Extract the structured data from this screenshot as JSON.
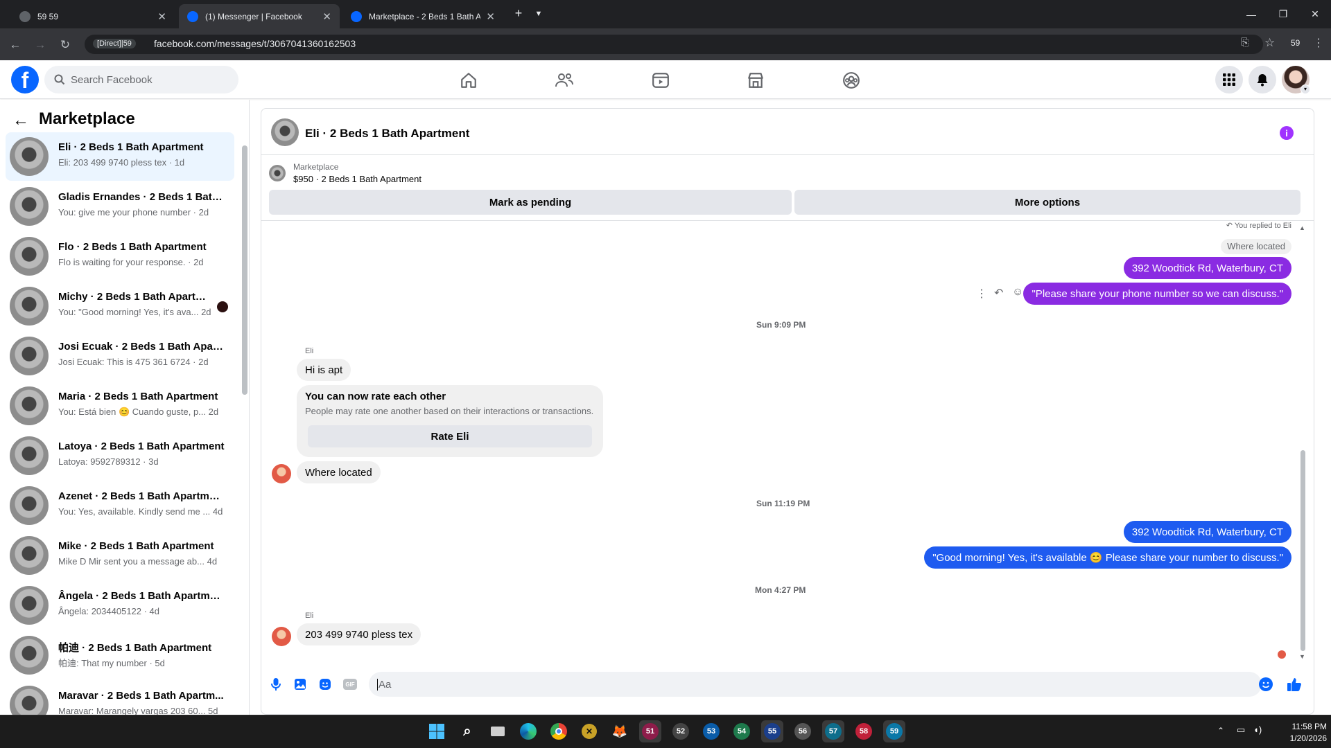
{
  "browser": {
    "tabs": [
      {
        "title": "59 59",
        "active": false
      },
      {
        "title": "(1) Messenger | Facebook",
        "active": true
      },
      {
        "title": "Marketplace - 2 Beds 1 Bath Ap",
        "active": false
      }
    ],
    "address_tag": "[Direct]|59",
    "url": "facebook.com/messages/t/3067041360162503",
    "profile_label": "59"
  },
  "fb": {
    "search_placeholder": "Search Facebook"
  },
  "sidebar": {
    "title": "Marketplace",
    "conversations": [
      {
        "name": "Eli · 2 Beds 1 Bath Apartment",
        "preview": "Eli: 203 499 9740 pless tex · 1d",
        "selected": true
      },
      {
        "name": "Gladis Ernandes · 2 Beds 1 Bath ...",
        "preview": "You: give me your phone number · 2d"
      },
      {
        "name": "Flo · 2 Beds 1 Bath Apartment",
        "preview": "Flo is waiting for your response. · 2d"
      },
      {
        "name": "Michy · 2 Beds 1 Bath Apartm...",
        "preview": "You: \"Good morning! Yes, it's ava... 2d",
        "unread": true
      },
      {
        "name": "Josi Ecuak · 2 Beds 1 Bath Apart...",
        "preview": "Josi Ecuak: This is 475 361 6724 · 2d"
      },
      {
        "name": "Maria · 2 Beds 1 Bath Apartment",
        "preview": "You: Está bien 😊 Cuando guste, p...  2d"
      },
      {
        "name": "Latoya · 2 Beds 1 Bath Apartment",
        "preview": "Latoya: 9592789312 · 3d"
      },
      {
        "name": "Azenet · 2 Beds 1 Bath Apartment",
        "preview": "You: Yes, available. Kindly send me ...  4d"
      },
      {
        "name": "Mike · 2 Beds 1 Bath Apartment",
        "preview": "Mike D Mir sent you a message ab...  4d"
      },
      {
        "name": "Ângela · 2 Beds 1 Bath Apartment",
        "preview": "Ângela: 2034405122 · 4d"
      },
      {
        "name": "帕迪 · 2 Beds 1 Bath Apartment",
        "preview": "帕迪: That my number · 5d"
      },
      {
        "name": "Maravar · 2 Beds 1 Bath Apartm...",
        "preview": "Maravar: Marangely vargas 203 60... 5d"
      }
    ]
  },
  "chat": {
    "title": "Eli · 2 Beds 1 Bath Apartment",
    "listing_label": "Marketplace",
    "listing_title": "$950 · 2 Beds 1 Bath Apartment",
    "mark_pending": "Mark as pending",
    "more_options": "More options",
    "replied_to": "You replied to Eli",
    "quoted": "Where located",
    "msg_out_1": "392 Woodtick Rd, Waterbury, CT",
    "msg_out_2": "\"Please share your phone number so we can discuss.\"",
    "time_1": "Sun 9:09 PM",
    "sender_name_1": "Eli",
    "msg_in_1": "Hi is apt",
    "rate_title": "You can now rate each other",
    "rate_desc": "People may rate one another based on their interactions or transactions.",
    "rate_button": "Rate Eli",
    "msg_in_2": "Where located",
    "time_2": "Sun 11:19 PM",
    "msg_out_3": "392 Woodtick Rd, Waterbury, CT",
    "msg_out_4": "\"Good morning! Yes, it's available 😊 Please share your number to discuss.\"",
    "time_3": "Mon 4:27 PM",
    "sender_name_2": "Eli",
    "msg_in_3": "203 499 9740 pless tex",
    "composer_placeholder": "Aa"
  },
  "taskbar": {
    "badges": [
      "51",
      "52",
      "53",
      "54",
      "55",
      "56",
      "57",
      "58",
      "59"
    ],
    "time": "11:58 PM",
    "date": "1/20/2026"
  },
  "colors": {
    "fb_blue": "#0866ff",
    "outgoing_purple": "#8a2be2",
    "outgoing_blue": "#1e5bf0"
  }
}
